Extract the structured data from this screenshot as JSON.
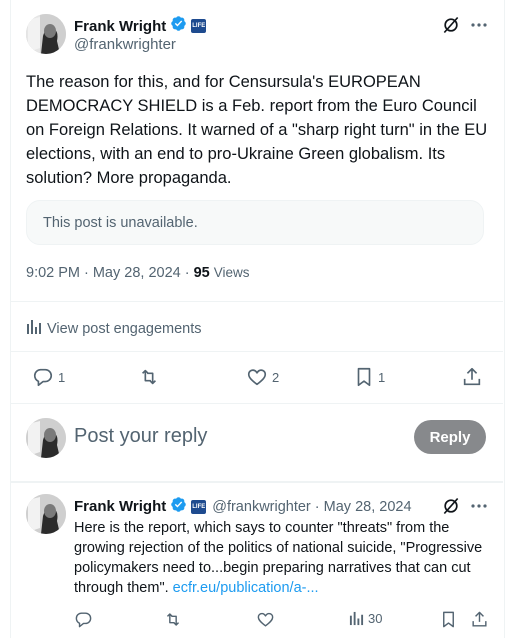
{
  "post": {
    "author_name": "Frank Wright",
    "handle": "@frankwrighter",
    "affiliation_badge": "LIFE",
    "text": "The reason for this, and for Censursula's EUROPEAN DEMOCRACY SHIELD is a Feb. report from the Euro Council on Foreign Relations. It warned of a \"sharp right turn\" in the EU elections, with an end to pro-Ukraine Green globalism. Its solution? More propaganda.",
    "unavailable_notice": "This post is unavailable.",
    "time": "9:02 PM",
    "date": "May 28, 2024",
    "dot": "·",
    "views_count": "95",
    "views_label": "Views",
    "engagements_label": "View post engagements",
    "stats": {
      "replies": "1",
      "retweets": "",
      "likes": "2",
      "bookmarks": "1"
    }
  },
  "reply_box": {
    "placeholder": "Post your reply",
    "button_label": "Reply"
  },
  "reply": {
    "author_name": "Frank Wright",
    "affiliation_badge": "LIFE",
    "handle_date": "@frankwrighter · May 28, 2024",
    "text": "Here is the report, which says to counter \"threats\" from the growing rejection of the politics of national suicide, \"Progressive policymakers need to...begin preparing narratives that can cut through them\".",
    "link_text": "ecfr.eu/publication/a-...",
    "stats": {
      "views": "30"
    }
  },
  "colors": {
    "accent": "#1d9bf0",
    "verified": "#1d9bf0",
    "text": "#0f1419",
    "muted": "#536471",
    "reply_button": "#87898c"
  },
  "icons": [
    "verified-badge-icon",
    "grok-icon",
    "more-icon",
    "reply-icon",
    "retweet-icon",
    "like-icon",
    "bookmark-icon",
    "share-icon",
    "analytics-icon"
  ]
}
